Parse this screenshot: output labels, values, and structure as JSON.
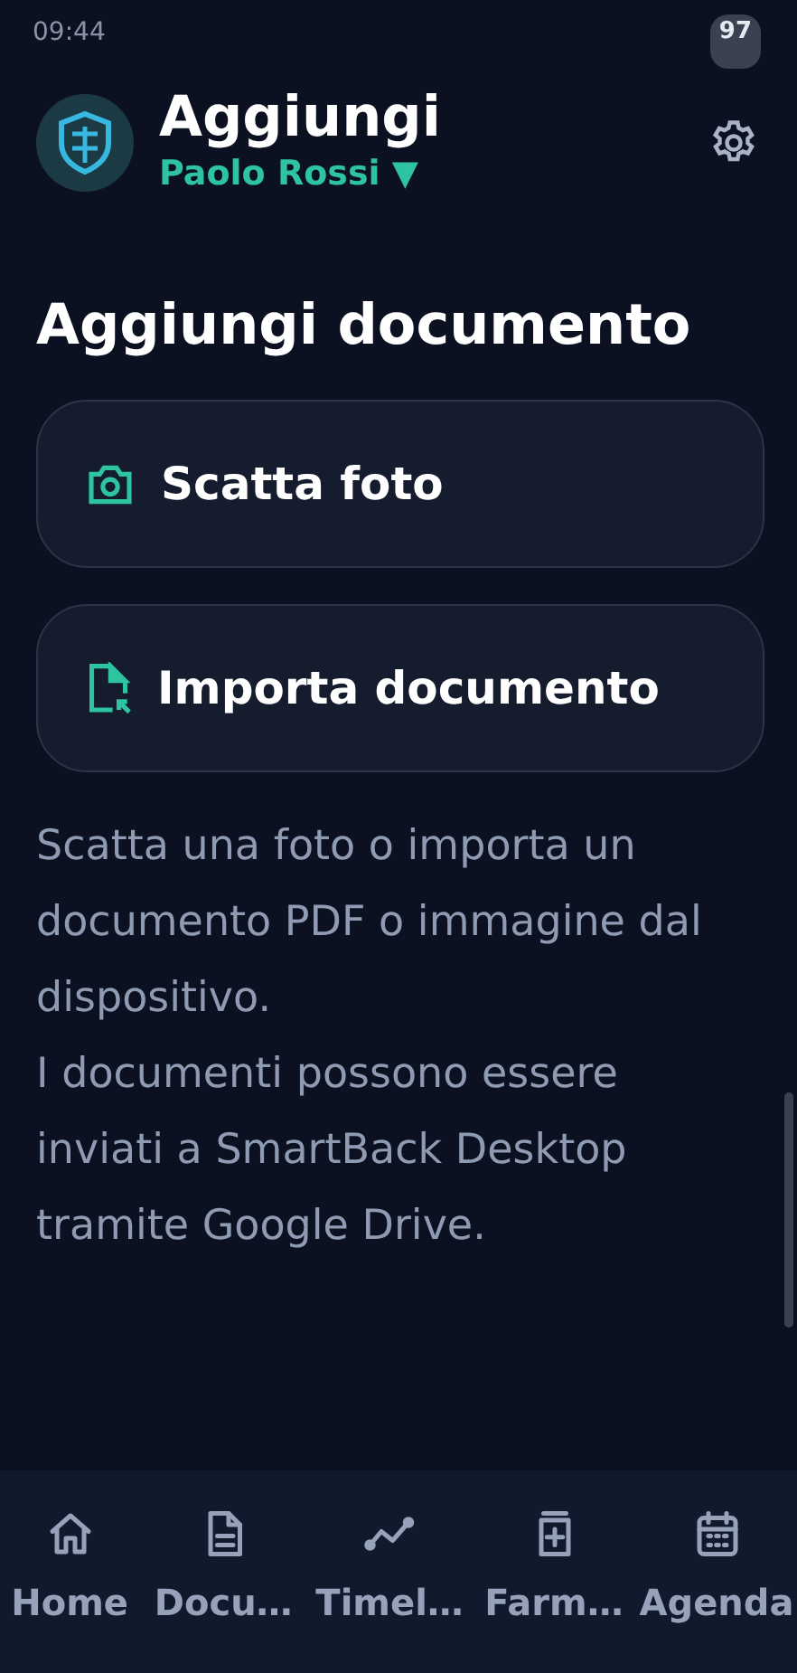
{
  "status_bar": {
    "time": "09:44",
    "battery": "97"
  },
  "header": {
    "title": "Aggiungi",
    "profile": "Paolo Rossi",
    "profile_caret": "▼"
  },
  "section_title": "Aggiungi documento",
  "actions": [
    {
      "kind": "camera",
      "label": "Scatta foto"
    },
    {
      "kind": "import",
      "label": "Importa documento"
    }
  ],
  "description": [
    "Scatta una foto o importa un documento PDF o immagine dal dispositivo.",
    "I documenti possono essere inviati a SmartBack Desktop tramite Google Drive."
  ],
  "bottom_nav": [
    {
      "kind": "home",
      "label": "Home",
      "selected": false
    },
    {
      "kind": "document",
      "label": "Docu…",
      "selected": false
    },
    {
      "kind": "timeline",
      "label": "Timel…",
      "selected": false
    },
    {
      "kind": "medicine",
      "label": "Farm…",
      "selected": false
    },
    {
      "kind": "calendar",
      "label": "Agenda",
      "selected": false
    }
  ]
}
